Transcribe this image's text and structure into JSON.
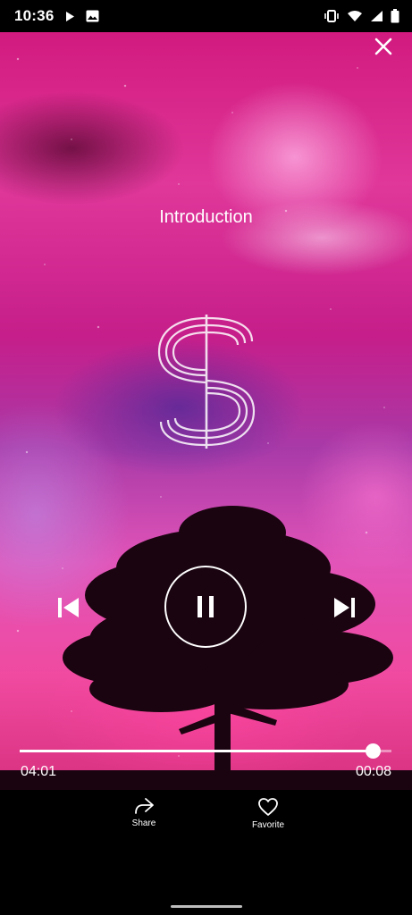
{
  "status_bar": {
    "time": "10:36",
    "icons": [
      "play-icon",
      "image-icon",
      "vibrate-icon",
      "wifi-icon",
      "signal-icon",
      "battery-icon"
    ]
  },
  "player": {
    "title": "Introduction",
    "elapsed": "04:01",
    "remaining": "00:08",
    "progress": 0.95,
    "state": "playing"
  },
  "actions": {
    "share_label": "Share",
    "favorite_label": "Favorite"
  },
  "colors": {
    "accent": "#ffffff",
    "background": "#000000",
    "art_primary": "#e0379a"
  }
}
